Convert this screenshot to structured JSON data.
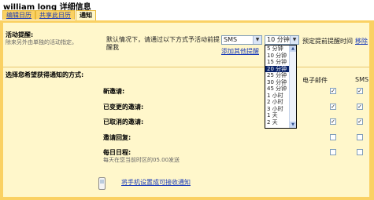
{
  "header": {
    "title": "william long 详细信息"
  },
  "tabs": [
    {
      "label": "编辑日历"
    },
    {
      "label": "共享此日历"
    },
    {
      "label": "通知"
    }
  ],
  "reminders": {
    "heading": "活动提醒:",
    "note": "除来另外由单独的活动指定。",
    "desc_line1": "默认情况下，请通过以下方式予活动前提",
    "desc_line2": "醒我",
    "method_value": "SMS",
    "time_value": "10 分钟",
    "add_link": "添加其他提醒",
    "preset_label": "预定提前提醒时间",
    "remove_link": "移除",
    "time_options": [
      "5 分钟",
      "10 分钟",
      "15 分钟",
      "20 分钟",
      "25 分钟",
      "30 分钟",
      "45 分钟",
      "1 小时",
      "2 小时",
      "3 小时",
      "1 天",
      "2 天"
    ],
    "highlighted_option": "20 分钟"
  },
  "notifications": {
    "heading": "选择您希望获得通知的方式:",
    "col_email": "电子邮件",
    "col_sms": "SMS",
    "rows": [
      {
        "label": "新邀请:",
        "email": true,
        "sms": true
      },
      {
        "label": "已变更的邀请:",
        "email": true,
        "sms": true
      },
      {
        "label": "已取消的邀请:",
        "email": true,
        "sms": true
      },
      {
        "label": "邀请回复:",
        "email": false,
        "sms": false
      },
      {
        "label": "每日日程:",
        "sublabel": "每天在您当前时区的05.00发送",
        "email": false,
        "sms": false
      }
    ],
    "phone_link": "将手机设置成可接收通知"
  }
}
